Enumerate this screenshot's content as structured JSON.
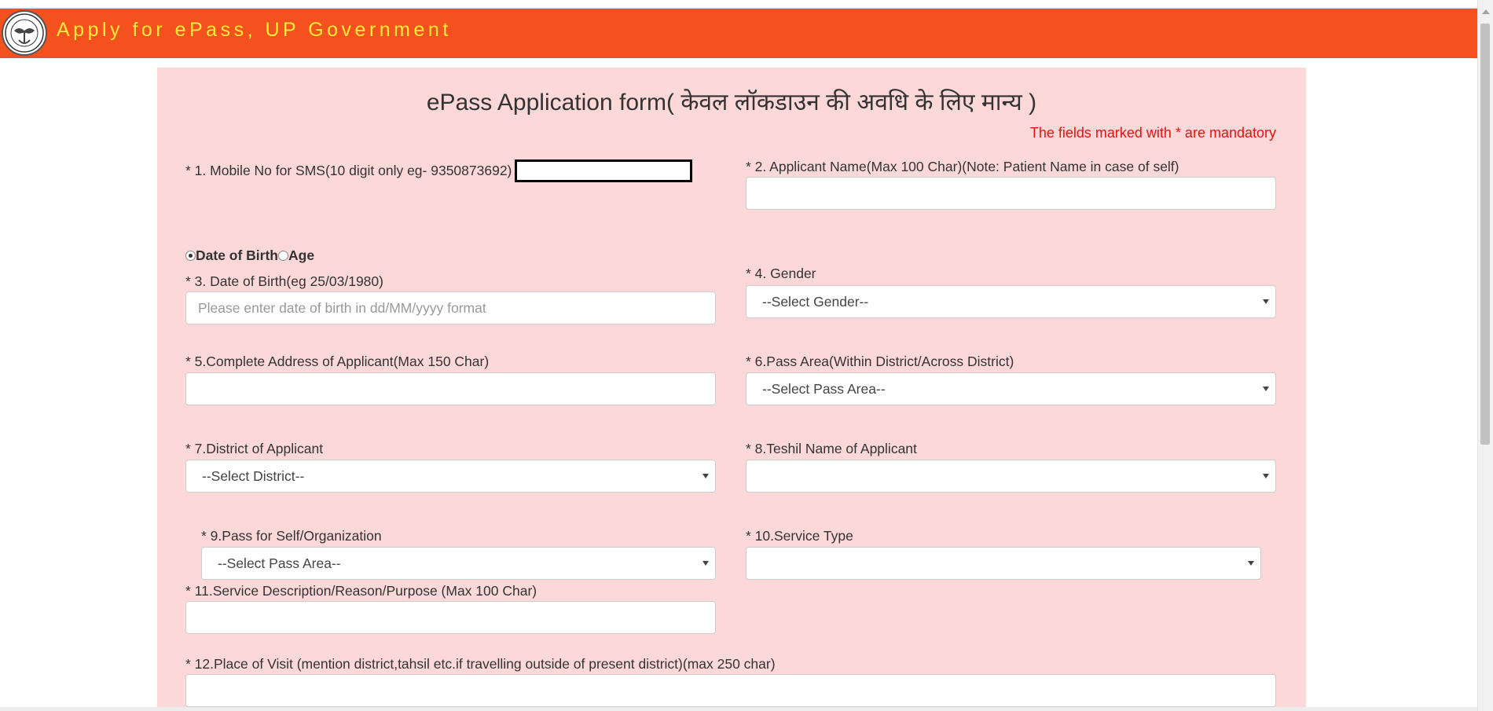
{
  "header": {
    "title": "Apply for ePass, UP Government",
    "logo_icon": "up-government-emblem-icon",
    "bg_color": "#f4511e",
    "title_color": "#ffeb3b"
  },
  "form": {
    "title": "ePass Application form( केवल लॉकडाउन की अवधि के लिए मान्य )",
    "mandatory_note": "The fields marked with * are mandatory",
    "panel_color": "#fcd9d8",
    "fields": {
      "mobile": {
        "label": "* 1. Mobile No for SMS(10 digit only eg- 9350873692)",
        "value": ""
      },
      "name": {
        "label": "* 2. Applicant Name(Max 100 Char)(Note: Patient Name in case of self)",
        "value": ""
      },
      "dob_mode": {
        "option_dob": "Date of Birth",
        "option_age": "Age",
        "selected": "Date of Birth"
      },
      "dob": {
        "label": "* 3. Date of Birth(eg 25/03/1980)",
        "placeholder": "Please enter date of birth in dd/MM/yyyy format",
        "value": ""
      },
      "gender": {
        "label": "* 4. Gender",
        "selected": "--Select Gender--"
      },
      "address": {
        "label": "* 5.Complete Address of Applicant(Max 150 Char)",
        "value": ""
      },
      "pass_area": {
        "label": "* 6.Pass Area(Within District/Across District)",
        "selected": "--Select Pass Area--"
      },
      "district": {
        "label": "* 7.District of Applicant",
        "selected": "--Select District--"
      },
      "tehsil": {
        "label": "* 8.Teshil Name of Applicant",
        "selected": ""
      },
      "pass_for": {
        "label": "* 9.Pass for Self/Organization",
        "selected": "--Select Pass Area--"
      },
      "service_type": {
        "label": "* 10.Service Type",
        "selected": ""
      },
      "service_desc": {
        "label": "* 11.Service Description/Reason/Purpose (Max 100 Char)",
        "value": ""
      },
      "place_of_visit": {
        "label": "* 12.Place of Visit (mention district,tahsil etc.if travelling outside of present district)(max 250 char)",
        "value": ""
      }
    }
  }
}
